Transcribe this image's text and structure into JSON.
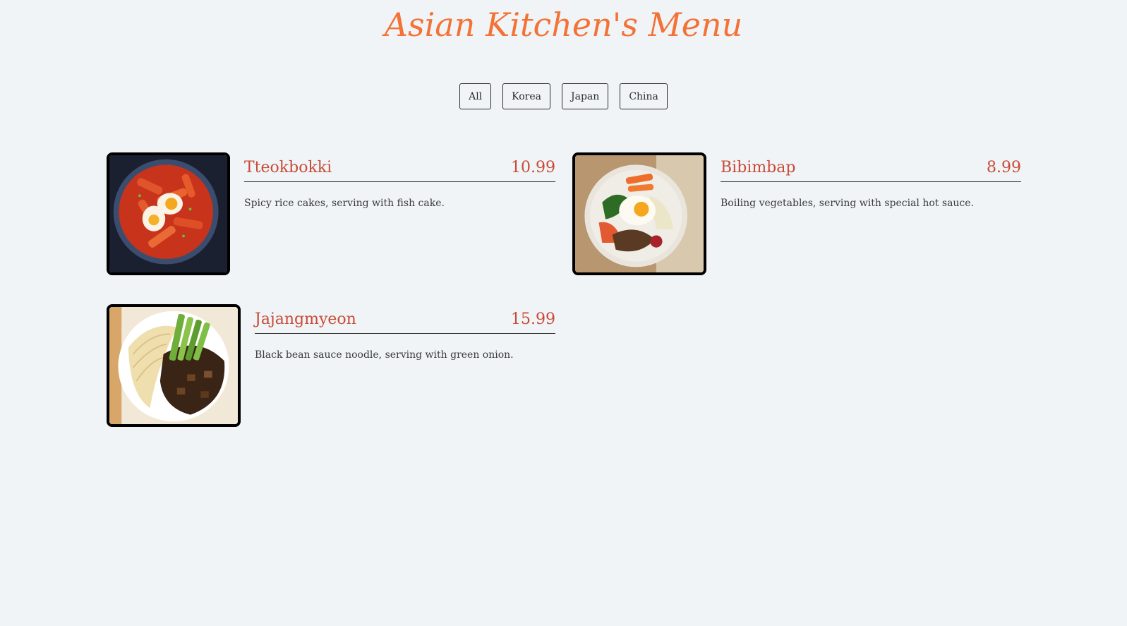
{
  "header": {
    "title": "Asian Kitchen's Menu"
  },
  "filters": [
    "All",
    "Korea",
    "Japan",
    "China"
  ],
  "menu": [
    {
      "name": "Tteokbokki",
      "price": "10.99",
      "description": "Spicy rice cakes, serving with fish cake."
    },
    {
      "name": "Bibimbap",
      "price": "8.99",
      "description": "Boiling vegetables, serving with special hot sauce."
    },
    {
      "name": "Jajangmyeon",
      "price": "15.99",
      "description": "Black bean sauce noodle, serving with green onion."
    }
  ],
  "colors": {
    "background": "#f0f4f7",
    "title": "#f47236",
    "dish_text": "#c84b36"
  }
}
